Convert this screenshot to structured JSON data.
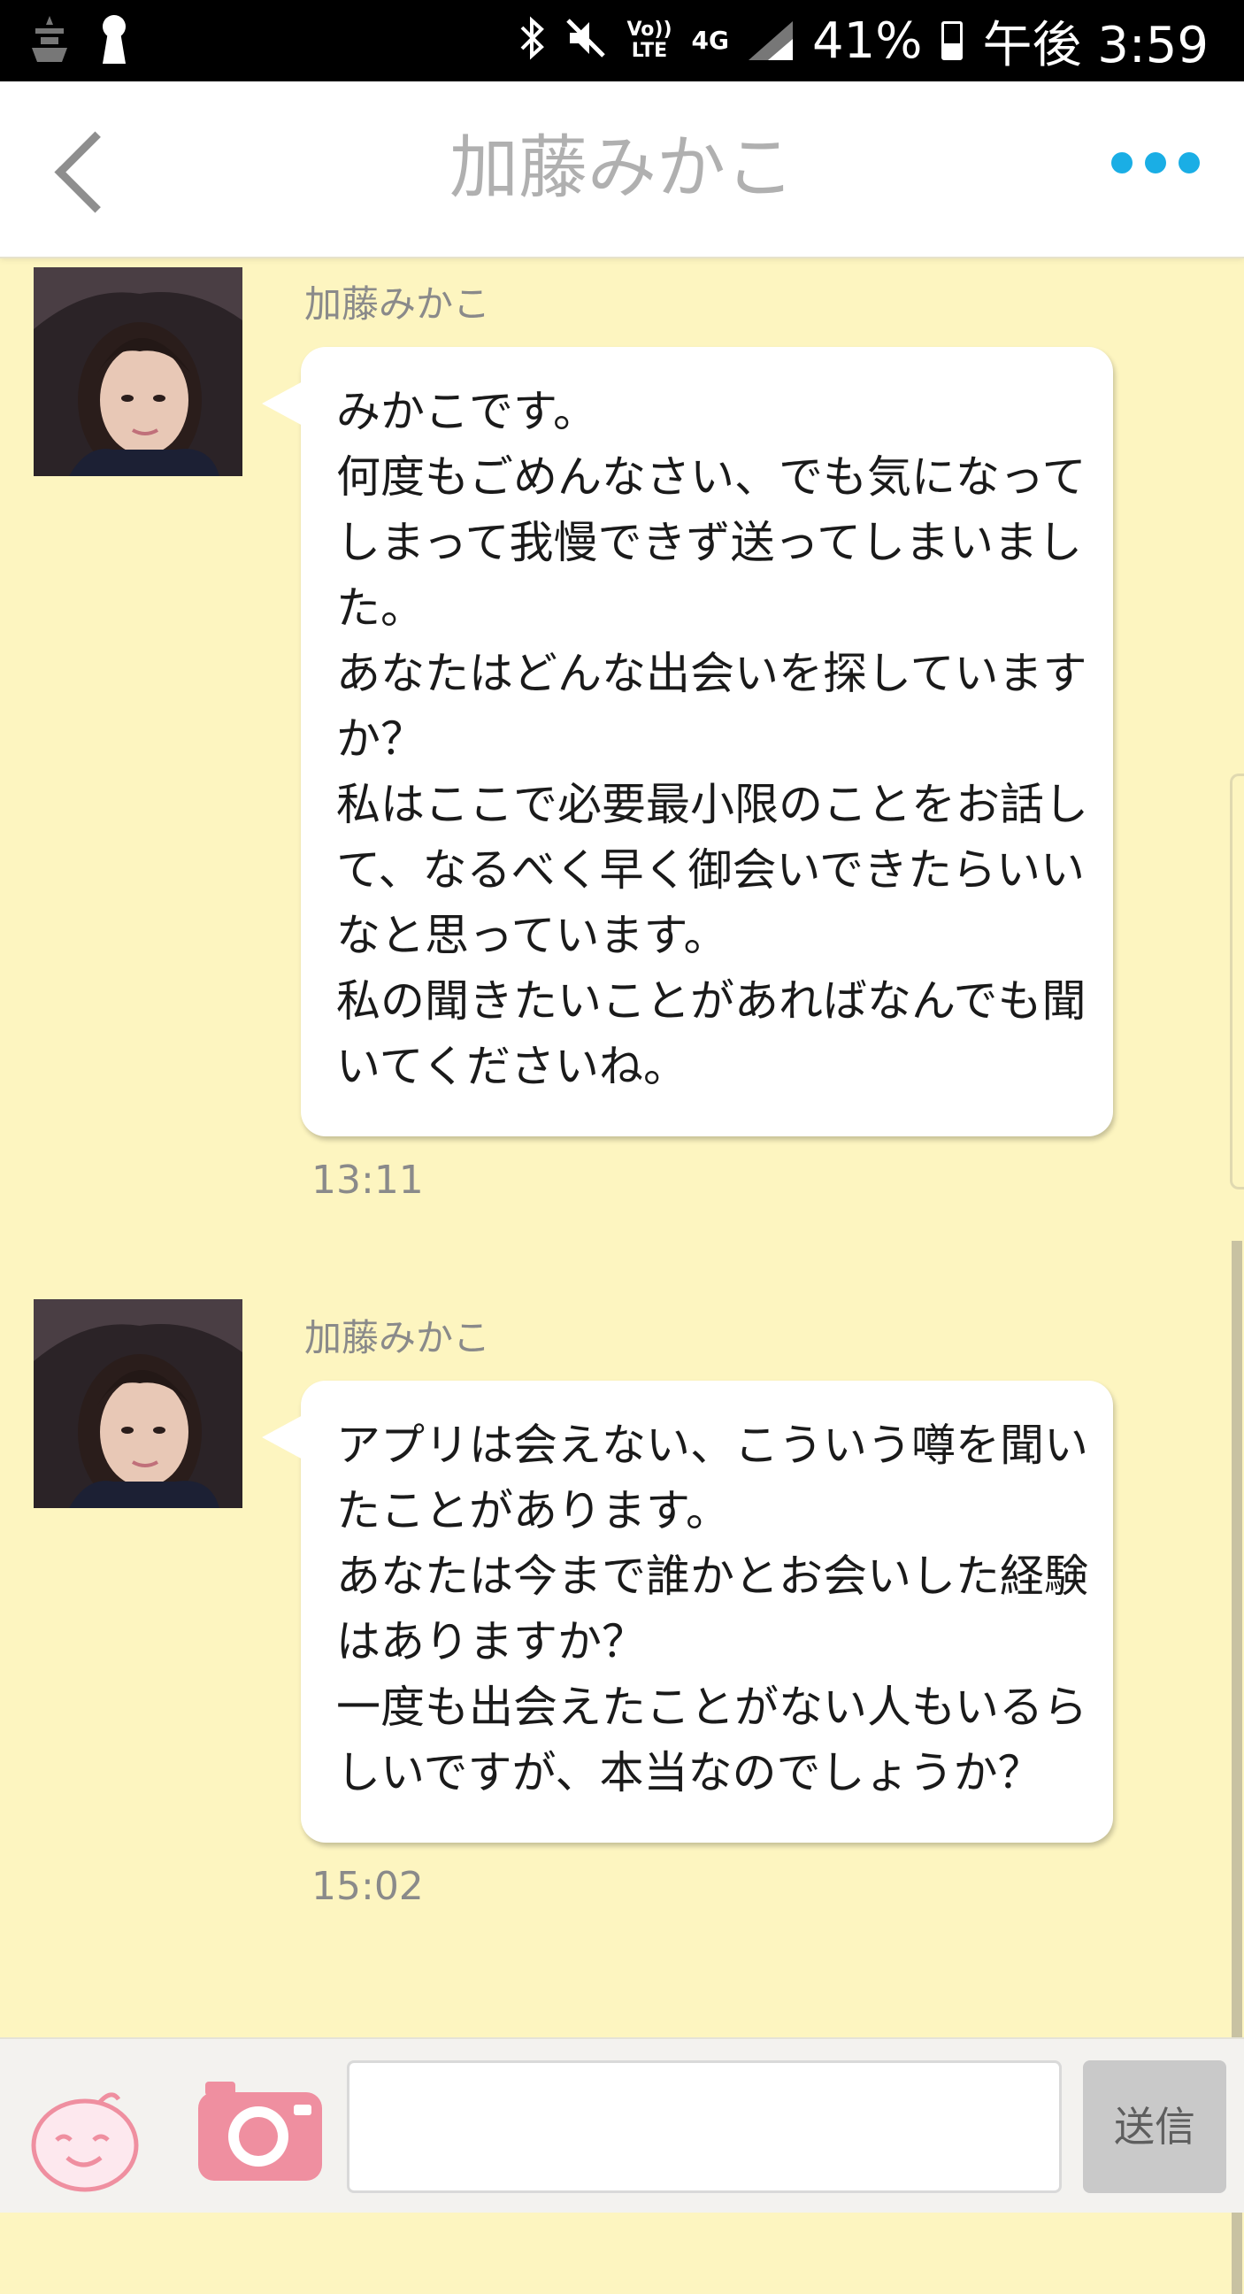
{
  "status_bar": {
    "battery": "41%",
    "time": "午後 3:59",
    "network": "4G",
    "volte_line1": "Vo))",
    "volte_line2": "LTE",
    "icons": [
      "app-notification-icon",
      "keyhole-icon",
      "bluetooth-icon",
      "mute-icon",
      "volte-icon",
      "4g-icon",
      "signal-icon",
      "battery-icon"
    ]
  },
  "header": {
    "title": "加藤みかこ",
    "back_icon": "chevron-left-icon",
    "more_icon": "more-dots-icon",
    "accent_color": "#1aaee5"
  },
  "messages": [
    {
      "sender": "加藤みかこ",
      "lines": [
        "みかこです。",
        "何度もごめんなさい、でも気になって",
        "しまって我慢できず送ってしまいまし",
        "た。",
        "あなたはどんな出会いを探しています",
        "か？",
        "私はここで必要最小限のことをお話し",
        "て、なるべく早く御会いできたらいい",
        "なと思っています。",
        "私の聞きたいことがあればなんでも聞",
        "いてくださいね。"
      ],
      "time": "13:11"
    },
    {
      "sender": "加藤みかこ",
      "lines": [
        "アプリは会えない、こういう噂を聞い",
        "たことがあります。",
        "あなたは今まで誰かとお会いした経験",
        "はありますか？",
        "一度も出会えたことがない人もいるら",
        "しいですが、本当なのでしょうか？"
      ],
      "time": "15:02"
    }
  ],
  "input_bar": {
    "placeholder": "",
    "send_label": "送信",
    "emoji_icon": "smile-face-icon",
    "camera_icon": "camera-icon"
  },
  "colors": {
    "background": "#fdf5c0",
    "bubble": "#ffffff",
    "camera_pink": "#ef8fa0"
  }
}
